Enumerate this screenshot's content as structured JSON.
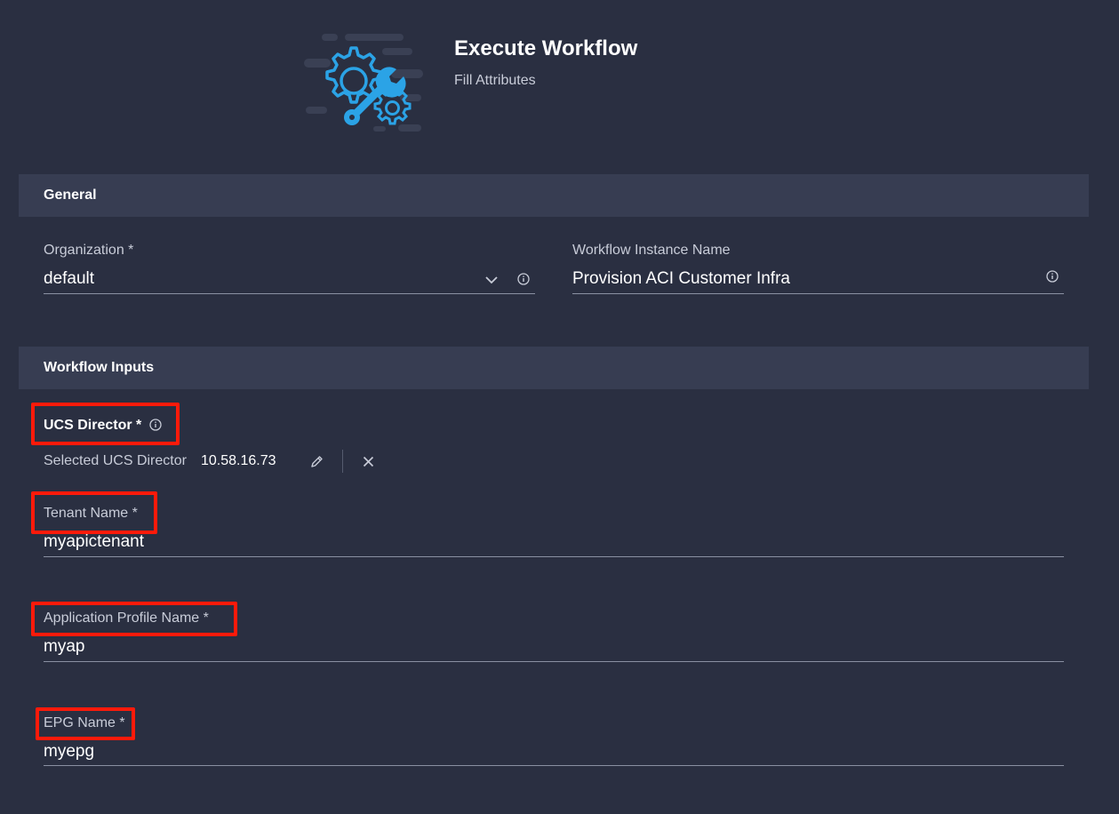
{
  "header": {
    "title": "Execute Workflow",
    "subtitle": "Fill Attributes",
    "illustration_icon": "gear-wrench-icon"
  },
  "sections": {
    "general": {
      "title": "General"
    },
    "workflow_inputs": {
      "title": "Workflow Inputs"
    }
  },
  "general": {
    "organization": {
      "label": "Organization *",
      "value": "default",
      "dropdown_icon": "chevron-down-icon",
      "info_icon": "info-icon"
    },
    "instance_name": {
      "label": "Workflow Instance Name",
      "value": "Provision ACI Customer Infra",
      "info_icon": "info-icon"
    }
  },
  "inputs": {
    "ucs_director": {
      "label": "UCS Director *",
      "info_icon": "info-icon",
      "selected_label": "Selected UCS Director",
      "selected_value": "10.58.16.73",
      "edit_icon": "pencil-icon",
      "clear_icon": "close-icon"
    },
    "tenant_name": {
      "label": "Tenant Name *",
      "value": "myapictenant"
    },
    "app_profile_name": {
      "label": "Application Profile Name *",
      "value": "myap"
    },
    "epg_name": {
      "label": "EPG Name *",
      "value": "myepg"
    }
  },
  "colors": {
    "background": "#2a2f41",
    "section_header": "#373d52",
    "accent": "#2ba3e6",
    "highlight": "#ff1a0a"
  }
}
